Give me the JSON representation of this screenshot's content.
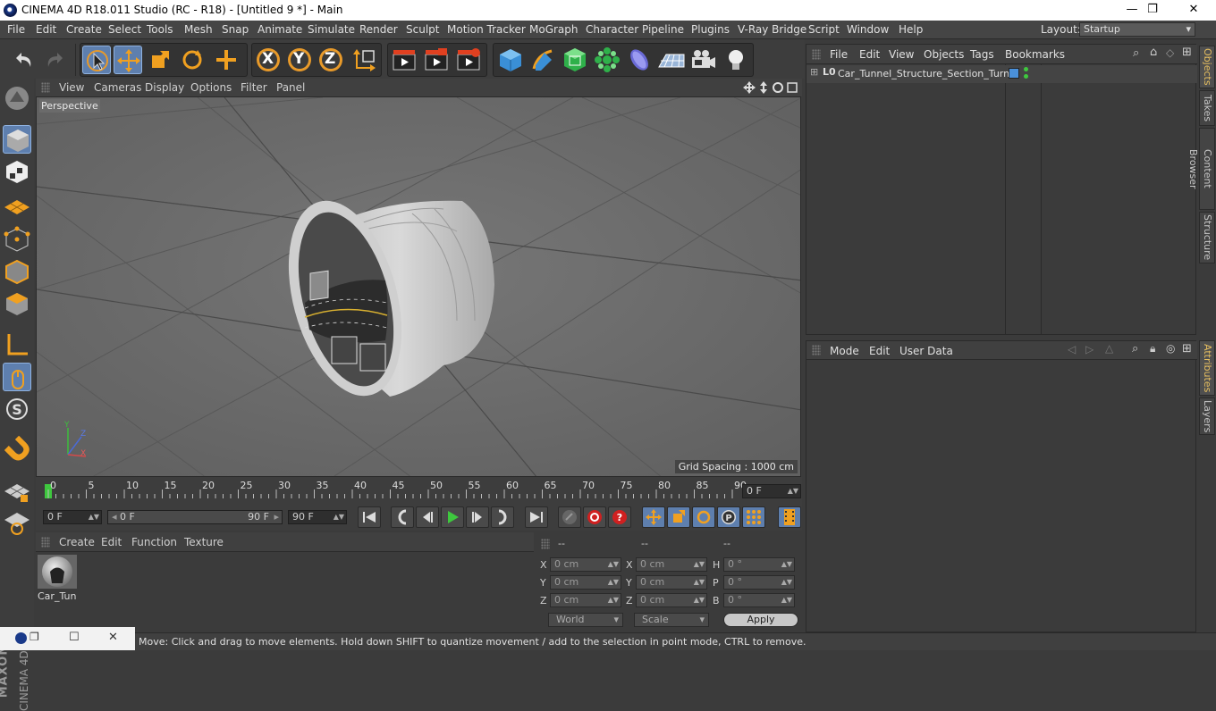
{
  "window": {
    "title": "CINEMA 4D R18.011 Studio (RC - R18) - [Untitled 9 *] - Main",
    "minimize": "—",
    "maximize": "❐",
    "close": "✕"
  },
  "menu": [
    "File",
    "Edit",
    "Create",
    "Select",
    "Tools",
    "Mesh",
    "Snap",
    "Animate",
    "Simulate",
    "Render",
    "Sculpt",
    "Motion Tracker",
    "MoGraph",
    "Character",
    "Pipeline",
    "Plugins",
    "V-Ray Bridge",
    "Script",
    "Window",
    "Help"
  ],
  "layout": {
    "label": "Layout:",
    "value": "Startup"
  },
  "toolbar": {
    "x_axis": "X",
    "y_axis": "Y",
    "z_axis": "Z"
  },
  "viewport": {
    "menu": [
      "View",
      "Cameras",
      "Display",
      "Options",
      "Filter",
      "Panel"
    ],
    "camera_label": "Perspective",
    "grid_spacing": "Grid Spacing : 1000 cm",
    "axis_x": "X",
    "axis_y": "Y",
    "axis_z": "Z"
  },
  "timeline": {
    "ticks": [
      "0",
      "5",
      "10",
      "15",
      "20",
      "25",
      "30",
      "35",
      "40",
      "45",
      "50",
      "55",
      "60",
      "65",
      "70",
      "75",
      "80",
      "85",
      "90"
    ],
    "current_frame": "0 F",
    "start_frame": "0 F",
    "range_start": "0 F",
    "range_end": "90 F",
    "end_frame": "90 F"
  },
  "material_manager": {
    "menu": [
      "Create",
      "Edit",
      "Function",
      "Texture"
    ],
    "material_name": "Car_Tun"
  },
  "coordinates": {
    "headers": [
      "--",
      "--",
      "--"
    ],
    "rows": [
      {
        "l1": "X",
        "v1": "0 cm",
        "l2": "X",
        "v2": "0 cm",
        "l3": "H",
        "v3": "0 °"
      },
      {
        "l1": "Y",
        "v1": "0 cm",
        "l2": "Y",
        "v2": "0 cm",
        "l3": "P",
        "v3": "0 °"
      },
      {
        "l1": "Z",
        "v1": "0 cm",
        "l2": "Z",
        "v2": "0 cm",
        "l3": "B",
        "v3": "0 °"
      }
    ],
    "world": "World",
    "scale": "Scale",
    "apply": "Apply"
  },
  "object_manager": {
    "menu": [
      "File",
      "Edit",
      "View",
      "Objects",
      "Tags",
      "Bookmarks"
    ],
    "object_name": "Car_Tunnel_Structure_Section_Turn",
    "layer_color": "#4a90d9"
  },
  "attributes": {
    "menu": [
      "Mode",
      "Edit",
      "User Data"
    ]
  },
  "right_tabs": [
    "Objects",
    "Takes",
    "Content Browser",
    "Structure",
    "Attributes",
    "Layers"
  ],
  "status": "Move: Click and drag to move elements. Hold down SHIFT to quantize movement / add to the selection in point mode, CTRL to remove.",
  "brand": {
    "maxon": "MAXON",
    "product": "CINEMA 4D"
  }
}
